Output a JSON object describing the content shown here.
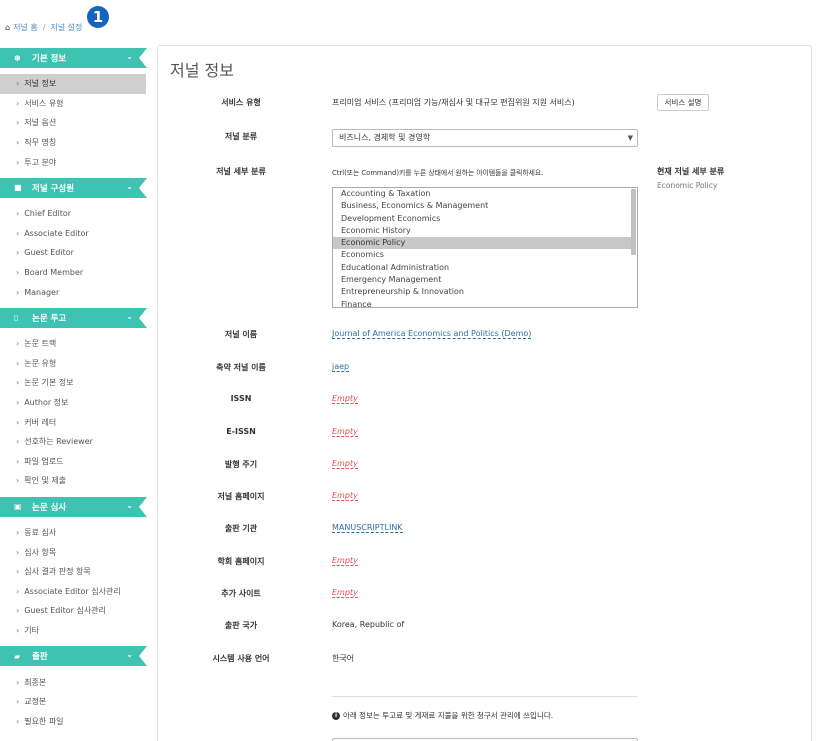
{
  "breadcrumb": {
    "home": "저널 홈",
    "separator": "/",
    "current": "저널 설정"
  },
  "step_badge": "1",
  "sidebar": {
    "sections": [
      {
        "icon": "gear-icon",
        "glyph": "✽",
        "title": "기본 정보",
        "items": [
          {
            "label": "저널 정보",
            "active": true
          },
          {
            "label": "서비스 유형"
          },
          {
            "label": "저널 옵션"
          },
          {
            "label": "직무 명칭"
          },
          {
            "label": "투고 분야"
          }
        ]
      },
      {
        "icon": "briefcase-icon",
        "glyph": "■",
        "title": "저널 구성원",
        "items": [
          {
            "label": "Chief Editor"
          },
          {
            "label": "Associate Editor"
          },
          {
            "label": "Guest Editor"
          },
          {
            "label": "Board Member"
          },
          {
            "label": "Manager"
          }
        ]
      },
      {
        "icon": "file-icon",
        "glyph": "▯",
        "title": "논문 투고",
        "items": [
          {
            "label": "논문 트랙"
          },
          {
            "label": "논문 유형"
          },
          {
            "label": "논문 기본 정보"
          },
          {
            "label": "Author 정보"
          },
          {
            "label": "커버 레터"
          },
          {
            "label": "선호하는 Reviewer"
          },
          {
            "label": "파일 업로드"
          },
          {
            "label": "확인 및 제출"
          }
        ]
      },
      {
        "icon": "edit-icon",
        "glyph": "▣",
        "title": "논문 심사",
        "items": [
          {
            "label": "동료 심사"
          },
          {
            "label": "심사 항목"
          },
          {
            "label": "심사 결과 판정 항목"
          },
          {
            "label": "Associate Editor 심사관리"
          },
          {
            "label": "Guest Editor 심사관리"
          },
          {
            "label": "기타"
          }
        ]
      },
      {
        "icon": "book-icon",
        "glyph": "▰",
        "title": "출판",
        "items": [
          {
            "label": "최종본"
          },
          {
            "label": "교정본"
          },
          {
            "label": "필요한 파일"
          }
        ]
      }
    ]
  },
  "main": {
    "title": "저널 정보",
    "service_type": {
      "label": "서비스 유형",
      "value": "프리미엄 서비스 (프리미엄 기능/재심사 및 대규모 편집위원 지원 서비스)",
      "button": "서비스 설명"
    },
    "category": {
      "label": "저널 분류",
      "selected": "비즈니스, 경제학 및 경영학"
    },
    "subcategory": {
      "label": "저널 세부 분류",
      "help": "Ctrl(또는 Command)키를 누른 상태에서 원하는 아이템들을 클릭하세요.",
      "options": [
        "Accounting & Taxation",
        "Business, Economics & Management",
        "Development Economics",
        "Economic History",
        "Economic Policy",
        "Economics",
        "Educational Administration",
        "Emergency Management",
        "Entrepreneurship & Innovation",
        "Finance"
      ],
      "selected_index": 4,
      "current_label": "현재 저널 세부 분류",
      "current_value": "Economic Policy"
    },
    "fields": [
      {
        "label": "저널 이름",
        "value": "Journal of America Economics and Politics (Demo)",
        "style": "link"
      },
      {
        "label": "축약 저널 이름",
        "value": "jaep",
        "style": "link"
      },
      {
        "label": "ISSN",
        "value": "Empty",
        "style": "empty"
      },
      {
        "label": "E-ISSN",
        "value": "Empty",
        "style": "empty"
      },
      {
        "label": "발행 주기",
        "value": "Empty",
        "style": "empty"
      },
      {
        "label": "저널 홈페이지",
        "value": "Empty",
        "style": "empty"
      },
      {
        "label": "출판 기관",
        "value": "MANUSCRIPTLINK",
        "style": "link"
      },
      {
        "label": "학회 홈페이지",
        "value": "Empty",
        "style": "empty"
      },
      {
        "label": "추가 사이트",
        "value": "Empty",
        "style": "empty"
      },
      {
        "label": "출판 국가",
        "value": "Korea, Republic of",
        "style": "plain"
      },
      {
        "label": "시스템 사용 언어",
        "value": "한국어",
        "style": "plain"
      }
    ],
    "info_note": "아래 정보는 투고료 및 게재료 지불을 위한 청구서 관리에 쓰입니다."
  },
  "colors": {
    "accent": "#3ec3b3",
    "link": "#2e6da4",
    "empty": "#d9534f",
    "badge": "#1565c0"
  }
}
